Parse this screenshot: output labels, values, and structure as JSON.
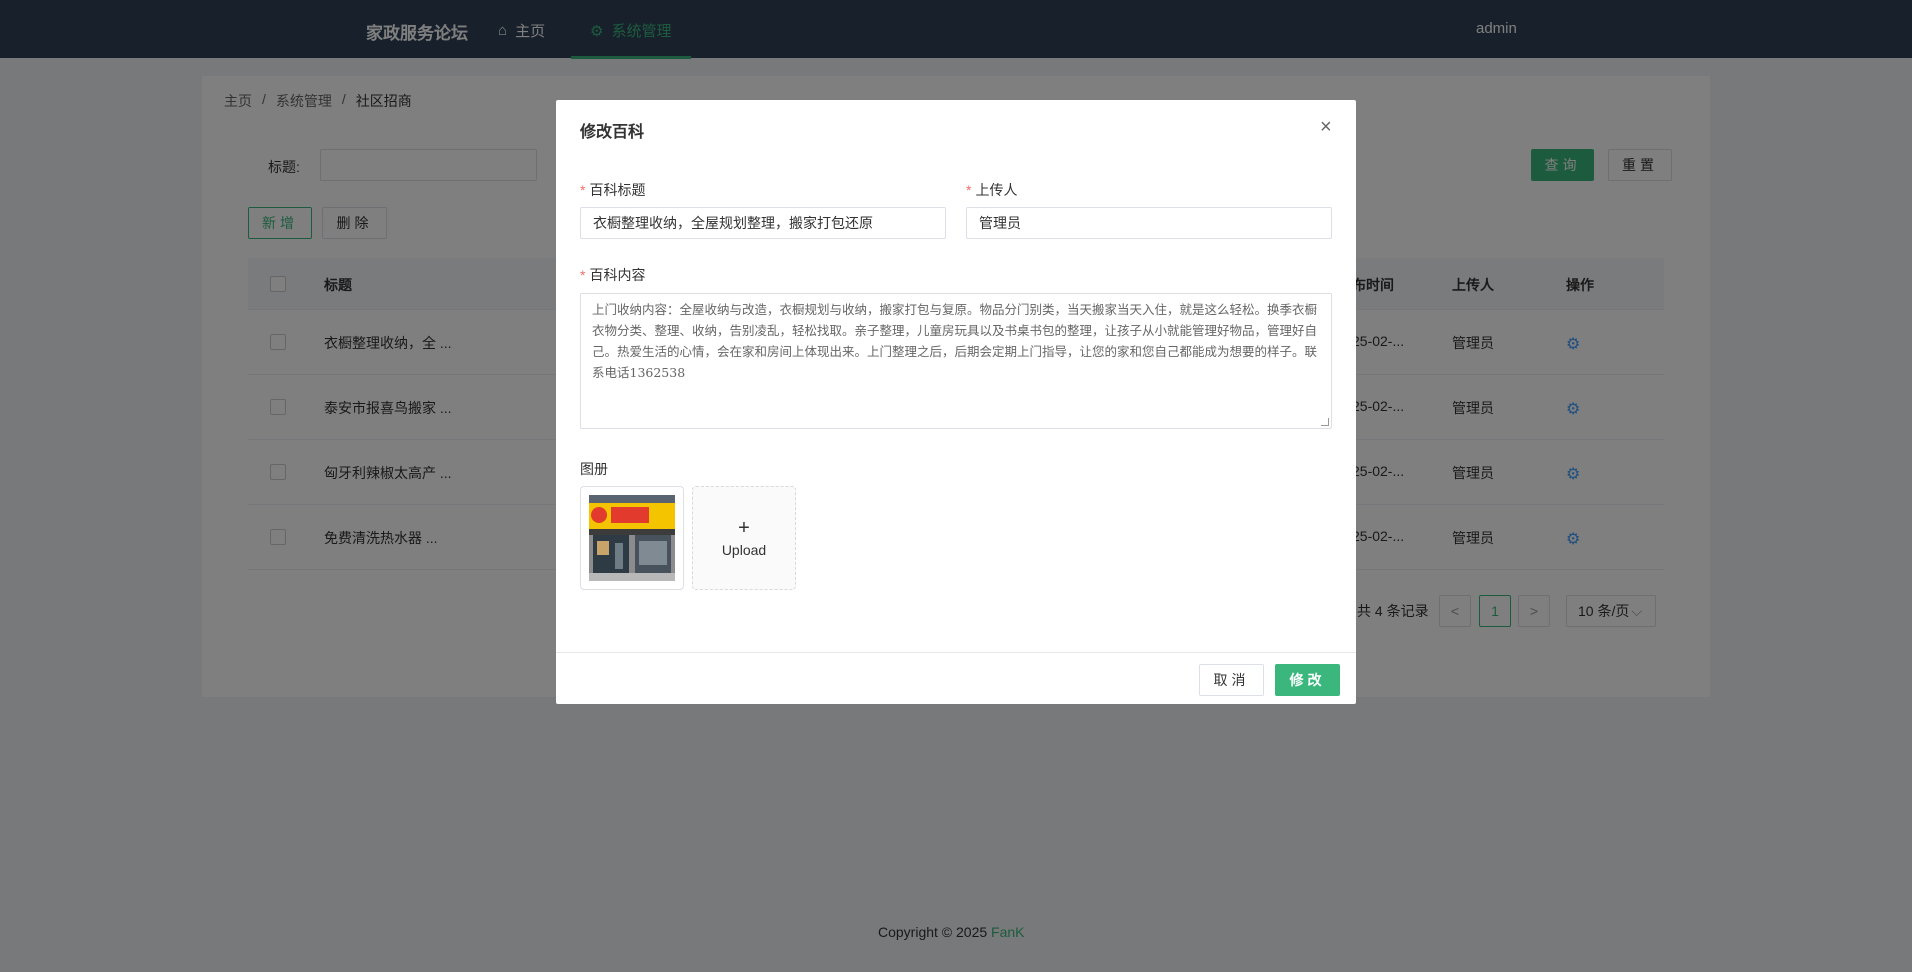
{
  "header": {
    "brand": "家政服务论坛",
    "nav": [
      {
        "label": "主页",
        "icon": "home-icon"
      },
      {
        "label": "系统管理",
        "icon": "settings-icon"
      }
    ],
    "user": "admin"
  },
  "breadcrumb": [
    "主页",
    "系统管理",
    "社区招商"
  ],
  "breadcrumb_sep": "/",
  "search": {
    "label": "标题:",
    "value": ""
  },
  "buttons": {
    "query": "查询",
    "reset": "重置",
    "add": "新增",
    "delete": "删除"
  },
  "table": {
    "columns": [
      "标题",
      "布时间",
      "上传人",
      "操作"
    ],
    "rows": [
      {
        "title": "衣橱整理收纳，全 ...",
        "time": "25-02-...",
        "uploader": "管理员"
      },
      {
        "title": "泰安市报喜鸟搬家 ...",
        "time": "25-02-...",
        "uploader": "管理员"
      },
      {
        "title": "匈牙利辣椒太高产 ...",
        "time": "25-02-...",
        "uploader": "管理员"
      },
      {
        "title": "免费清洗热水器 ...",
        "time": "25-02-...",
        "uploader": "管理员"
      }
    ]
  },
  "pagination": {
    "total_text": "共 4 条记录",
    "current": "1",
    "page_size": "10 条/页",
    "prev": "<",
    "next": ">"
  },
  "footer": {
    "text": "Copyright © 2025 ",
    "author": "FanK"
  },
  "dialog": {
    "title": "修改百科",
    "close": "×",
    "fields": {
      "title_label": "百科标题",
      "title_value": "衣橱整理收纳，全屋规划整理，搬家打包还原",
      "uploader_label": "上传人",
      "uploader_value": "管理员",
      "content_label": "百科内容",
      "content_value": "上门收纳内容：全屋收纳与改造，衣橱规划与收纳，搬家打包与复原。物品分门别类，当天搬家当天入住，就是这么轻松。换季衣橱衣物分类、整理、收纳，告别凌乱，轻松找取。亲子整理，儿童房玩具以及书桌书包的整理，让孩子从小就能管理好物品，管理好自己。热爱生活的心情，会在家和房间上体现出来。上门整理之后，后期会定期上门指导，让您的家和您自己都能成为想要的样子。联系电话1362538",
      "gallery_label": "图册",
      "upload_label": "Upload",
      "required_mark": "*"
    },
    "buttons": {
      "cancel": "取消",
      "submit": "修改"
    }
  },
  "colors": {
    "accent": "#3bb77e",
    "header_bg": "#304156",
    "required": "#f56c6c",
    "link": "#409eff"
  }
}
